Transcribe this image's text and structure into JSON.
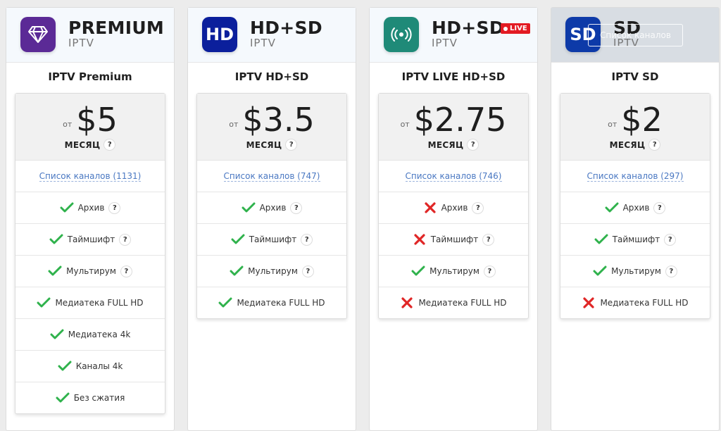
{
  "cards": [
    {
      "brand_main": "PREMIUM",
      "brand_sub": "IPTV",
      "logo_icon": "diamond-icon",
      "logo_color": "#5b2a96",
      "title": "IPTV Premium",
      "from": "от",
      "price": "$5",
      "period": "МЕСЯЦ",
      "channels": "Список каналов (1131)",
      "features": [
        {
          "label": "Архив",
          "ok": true,
          "help": true
        },
        {
          "label": "Таймшифт",
          "ok": true,
          "help": true
        },
        {
          "label": "Мультирум",
          "ok": true,
          "help": true
        },
        {
          "label": "Медиатека FULL HD",
          "ok": true,
          "help": false
        },
        {
          "label": "Медиатека 4k",
          "ok": true,
          "help": false
        },
        {
          "label": "Каналы 4k",
          "ok": true,
          "help": false
        },
        {
          "label": "Без сжатия",
          "ok": true,
          "help": false
        }
      ]
    },
    {
      "brand_main": "HD+SD",
      "brand_sub": "IPTV",
      "logo_text": "HD",
      "logo_color": "#0b1f9c",
      "title": "IPTV HD+SD",
      "from": "от",
      "price": "$3.5",
      "period": "МЕСЯЦ",
      "channels": "Список каналов (747)",
      "features": [
        {
          "label": "Архив",
          "ok": true,
          "help": true
        },
        {
          "label": "Таймшифт",
          "ok": true,
          "help": true
        },
        {
          "label": "Мультирум",
          "ok": true,
          "help": true
        },
        {
          "label": "Медиатека FULL HD",
          "ok": true,
          "help": false
        }
      ]
    },
    {
      "brand_main": "HD+SD",
      "brand_sub": "IPTV",
      "live_badge": "LIVE",
      "logo_icon": "broadcast-icon",
      "logo_color": "#1f8a78",
      "title": "IPTV LIVE HD+SD",
      "from": "от",
      "price": "$2.75",
      "period": "МЕСЯЦ",
      "channels": "Список каналов (746)",
      "features": [
        {
          "label": "Архив",
          "ok": false,
          "help": true
        },
        {
          "label": "Таймшифт",
          "ok": false,
          "help": true
        },
        {
          "label": "Мультирум",
          "ok": true,
          "help": true
        },
        {
          "label": "Медиатека FULL HD",
          "ok": false,
          "help": false
        }
      ]
    },
    {
      "brand_main": "SD",
      "brand_sub": "IPTV",
      "logo_text": "SD",
      "logo_color": "#0d3aa8",
      "overlay_button": "Список каналов",
      "title": "IPTV SD",
      "from": "от",
      "price": "$2",
      "period": "МЕСЯЦ",
      "channels": "Список каналов (297)",
      "features": [
        {
          "label": "Архив",
          "ok": true,
          "help": true
        },
        {
          "label": "Таймшифт",
          "ok": true,
          "help": true
        },
        {
          "label": "Мультирум",
          "ok": true,
          "help": true
        },
        {
          "label": "Медиатека FULL HD",
          "ok": false,
          "help": false
        }
      ]
    }
  ],
  "help_glyph": "?",
  "colors": {
    "check": "#2fb24c",
    "cross": "#e02626",
    "link": "#4a78c2",
    "live": "#e31b23"
  }
}
